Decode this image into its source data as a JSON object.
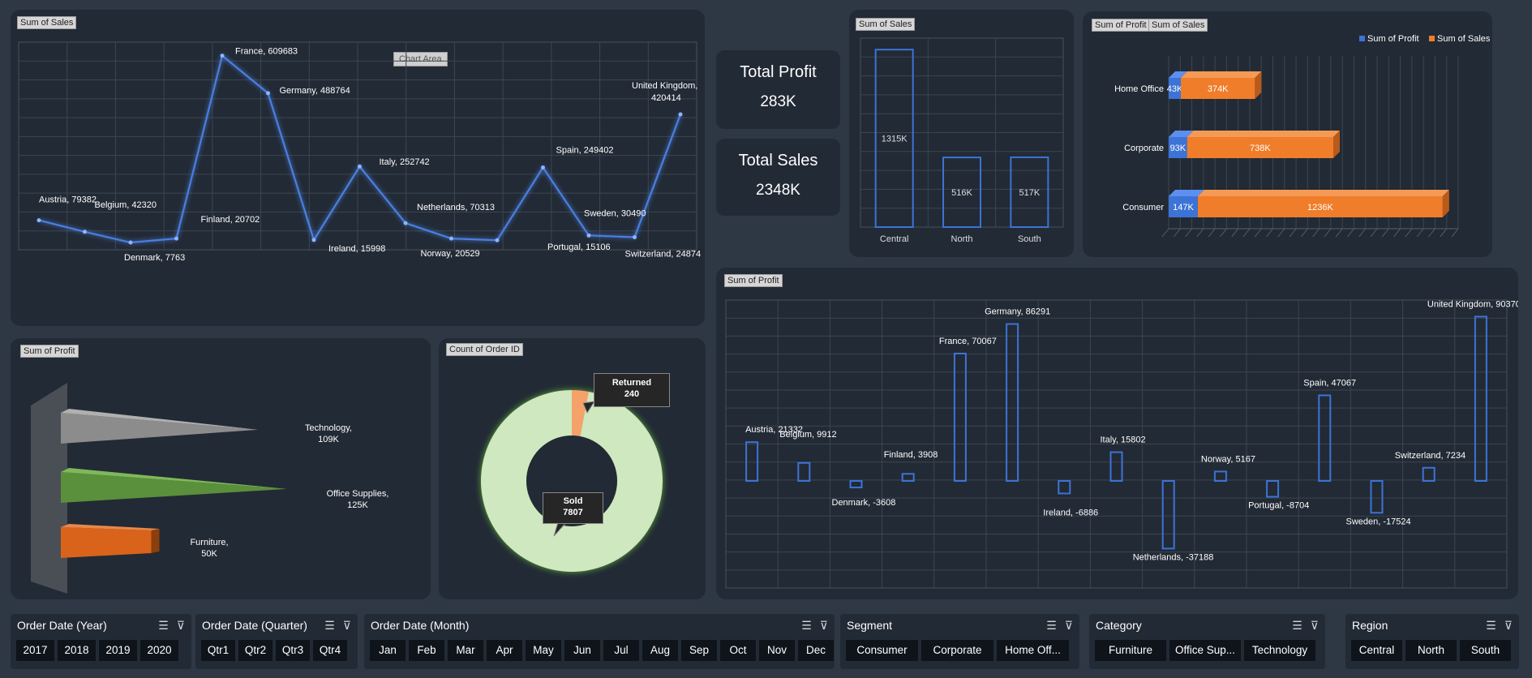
{
  "panels": {
    "line_title": "Sum of Sales",
    "chart_area_label": "Chart Area",
    "region_bar_title": "Sum of Sales",
    "segment_titles": [
      "Sum of Profit",
      "Sum of Sales"
    ],
    "category_title": "Sum of Profit",
    "donut_title": "Count of Order ID",
    "profit_country_title": "Sum of Profit"
  },
  "kpis": [
    {
      "label": "Total Profit",
      "value": "283K"
    },
    {
      "label": "Total Sales",
      "value": "2348K"
    }
  ],
  "chart_data": [
    {
      "type": "line",
      "title": "Sum of Sales",
      "categories": [
        "Austria",
        "Belgium",
        "Denmark",
        "Finland",
        "France",
        "Germany",
        "Ireland",
        "Italy",
        "Netherlands",
        "Norway",
        "Portugal",
        "Spain",
        "Sweden",
        "Switzerland",
        "United Kingdom"
      ],
      "values": [
        79382,
        42320,
        7763,
        20702,
        609683,
        488764,
        15998,
        252742,
        70313,
        20529,
        15106,
        249402,
        30490,
        24874,
        420414
      ],
      "color": "#4a7fe0",
      "grid": true
    },
    {
      "type": "bar",
      "title": "Sum of Sales",
      "categories": [
        "Central",
        "North",
        "South"
      ],
      "values": [
        1315,
        516,
        517
      ],
      "labels": [
        "1315K",
        "516K",
        "517K"
      ],
      "color": "#3c73d6"
    },
    {
      "type": "bar",
      "orientation": "horizontal-stacked",
      "title": "Sum of Profit / Sum of Sales",
      "categories": [
        "Home Office",
        "Corporate",
        "Consumer"
      ],
      "series": [
        {
          "name": "Sum of Profit",
          "values": [
            43,
            93,
            147
          ],
          "labels": [
            "43K",
            "93K",
            "147K"
          ],
          "color": "#3c73d6"
        },
        {
          "name": "Sum of Sales",
          "values": [
            374,
            738,
            1236
          ],
          "labels": [
            "374K",
            "738K",
            "1236K"
          ],
          "color": "#f07d2a"
        }
      ],
      "legend": "top-right"
    },
    {
      "type": "bar",
      "orientation": "horizontal",
      "title": "Sum of Profit",
      "categories": [
        "Technology",
        "Office Supplies",
        "Furniture"
      ],
      "values": [
        109,
        125,
        50
      ],
      "labels": [
        "Technology,\n109K",
        "Office Supplies,\n125K",
        "Furniture,\n50K"
      ],
      "colors": [
        "#8c8c8c",
        "#5a8f3b",
        "#d9631a"
      ]
    },
    {
      "type": "pie",
      "title": "Count of Order ID",
      "categories": [
        "Returned",
        "Sold"
      ],
      "values": [
        240,
        7807
      ],
      "colors": [
        "#f5a26a",
        "#cfe8c0"
      ]
    },
    {
      "type": "bar",
      "title": "Sum of Profit",
      "categories": [
        "Austria",
        "Belgium",
        "Denmark",
        "Finland",
        "France",
        "Germany",
        "Ireland",
        "Italy",
        "Netherlands",
        "Norway",
        "Portugal",
        "Spain",
        "Sweden",
        "Switzerland",
        "United Kingdom"
      ],
      "values": [
        21332,
        9912,
        -3608,
        3908,
        70067,
        86291,
        -6886,
        15802,
        -37188,
        5167,
        -8704,
        47067,
        -17524,
        7234,
        90370
      ],
      "color": "#3c73d6",
      "grid": true
    }
  ],
  "slicers": [
    {
      "title": "Order Date (Year)",
      "items": [
        "2017",
        "2018",
        "2019",
        "2020"
      ]
    },
    {
      "title": "Order Date (Quarter)",
      "items": [
        "Qtr1",
        "Qtr2",
        "Qtr3",
        "Qtr4"
      ]
    },
    {
      "title": "Order Date (Month)",
      "items": [
        "Jan",
        "Feb",
        "Mar",
        "Apr",
        "May",
        "Jun",
        "Jul",
        "Aug",
        "Sep",
        "Oct",
        "Nov",
        "Dec"
      ]
    },
    {
      "title": "Segment",
      "items": [
        "Consumer",
        "Corporate",
        "Home Off..."
      ]
    },
    {
      "title": "Category",
      "items": [
        "Furniture",
        "Office Sup...",
        "Technology"
      ]
    },
    {
      "title": "Region",
      "items": [
        "Central",
        "North",
        "South"
      ]
    }
  ]
}
